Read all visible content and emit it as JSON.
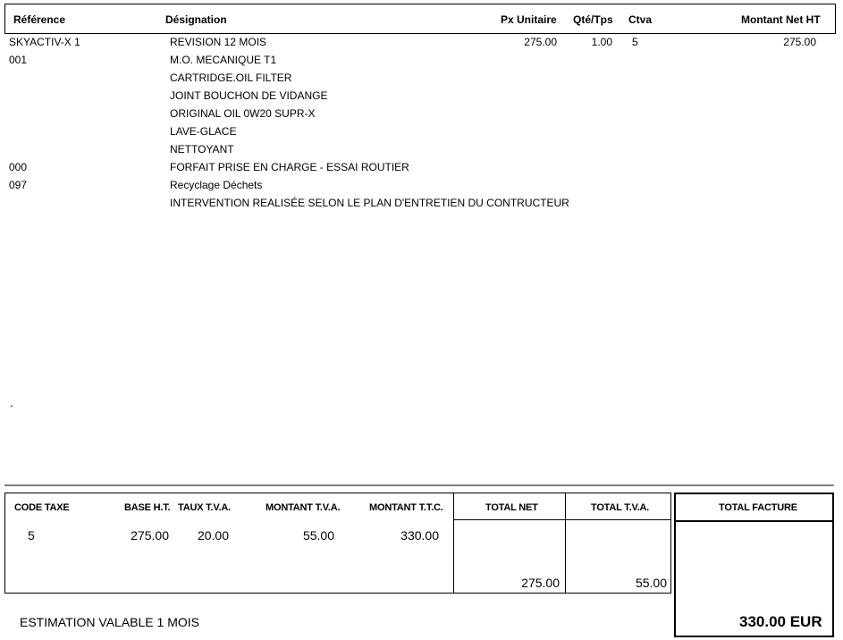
{
  "header": {
    "reference": "Référence",
    "designation": "Désignation",
    "px_unitaire": "Px Unitaire",
    "qte_tps": "Qté/Tps",
    "ctva": "Ctva",
    "montant_net_ht": "Montant Net HT"
  },
  "lines": [
    {
      "ref": "SKYACTIV-X 1",
      "designation": "REVISION 12 MOIS",
      "px": "275.00",
      "qte": "1.00",
      "ctva": "5",
      "montant": "275.00"
    },
    {
      "ref": "001",
      "designation": "M.O. MECANIQUE T1",
      "px": "",
      "qte": "",
      "ctva": "",
      "montant": ""
    },
    {
      "ref": "",
      "designation": "CARTRIDGE.OIL FILTER",
      "px": "",
      "qte": "",
      "ctva": "",
      "montant": ""
    },
    {
      "ref": "",
      "designation": "JOINT BOUCHON DE VIDANGE",
      "px": "",
      "qte": "",
      "ctva": "",
      "montant": ""
    },
    {
      "ref": "",
      "designation": "ORIGINAL OIL 0W20 SUPR-X",
      "px": "",
      "qte": "",
      "ctva": "",
      "montant": ""
    },
    {
      "ref": "",
      "designation": "LAVE-GLACE",
      "px": "",
      "qte": "",
      "ctva": "",
      "montant": ""
    },
    {
      "ref": "",
      "designation": "NETTOYANT",
      "px": "",
      "qte": "",
      "ctva": "",
      "montant": ""
    },
    {
      "ref": "000",
      "designation": "FORFAIT PRISE EN CHARGE - ESSAI ROUTIER",
      "px": "",
      "qte": "",
      "ctva": "",
      "montant": ""
    },
    {
      "ref": "097",
      "designation": "Recyclage Déchets",
      "px": "",
      "qte": "",
      "ctva": "",
      "montant": ""
    },
    {
      "ref": "",
      "designation": "INTERVENTION REALISÉE SELON LE PLAN D'ENTRETIEN DU CONTRUCTEUR",
      "px": "",
      "qte": "",
      "ctva": "",
      "montant": ""
    }
  ],
  "dot": ".",
  "tax_header": {
    "code_taxe": "CODE TAXE",
    "base_ht": "BASE H.T.",
    "taux_tva": "TAUX T.V.A.",
    "montant_tva": "MONTANT T.V.A.",
    "montant_ttc": "MONTANT T.T.C.",
    "total_net": "TOTAL NET",
    "total_tva": "TOTAL T.V.A.",
    "total_facture": "TOTAL FACTURE"
  },
  "tax_row": {
    "code": "5",
    "base": "275.00",
    "taux": "20.00",
    "montant_tva": "55.00",
    "montant_ttc": "330.00"
  },
  "totals": {
    "total_net": "275.00",
    "total_tva": "55.00",
    "total_facture": "330.00 EUR"
  },
  "footer": {
    "note": "ESTIMATION VALABLE 1 MOIS"
  }
}
